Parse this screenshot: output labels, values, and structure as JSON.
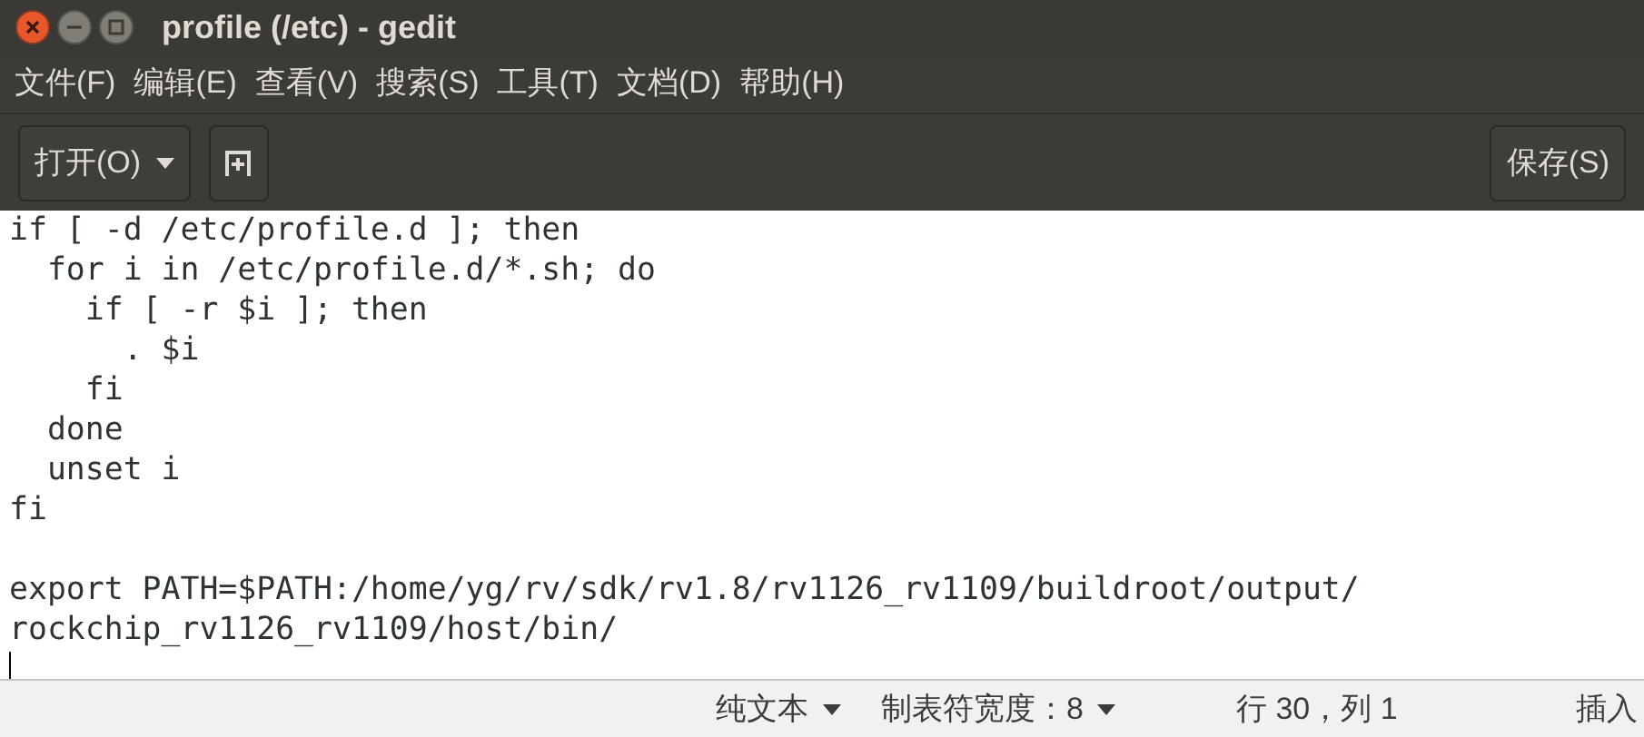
{
  "window": {
    "title": "profile (/etc) - gedit"
  },
  "menu": [
    "文件(F)",
    "编辑(E)",
    "查看(V)",
    "搜索(S)",
    "工具(T)",
    "文档(D)",
    "帮助(H)"
  ],
  "toolbar": {
    "open_button": "打开(O)",
    "save_button": "保存(S)"
  },
  "editor": {
    "lines": [
      {
        "kind": "text",
        "text": "if [ -d /etc/profile.d ]; then"
      },
      {
        "kind": "text",
        "text": "  for i in /etc/profile.d/*.sh; do"
      },
      {
        "kind": "text",
        "text": "    if [ -r $i ]; then"
      },
      {
        "kind": "text",
        "text": "      . $i"
      },
      {
        "kind": "text",
        "text": "    fi"
      },
      {
        "kind": "text",
        "text": "  done"
      },
      {
        "kind": "text",
        "text": "  unset i"
      },
      {
        "kind": "text",
        "text": "fi"
      },
      {
        "kind": "blank"
      },
      {
        "kind": "text",
        "text": "export PATH=$PATH:/home/yg/rv/sdk/rv1.8/rv1126_rv1109/buildroot/output/"
      },
      {
        "kind": "text",
        "text": "rockchip_rv1126_rv1109/host/bin/"
      },
      {
        "kind": "cursor"
      }
    ]
  },
  "status_bar": {
    "language": "纯文本",
    "tab_width": "制表符宽度：8",
    "position": "行 30，列 1",
    "mode": "插入"
  }
}
